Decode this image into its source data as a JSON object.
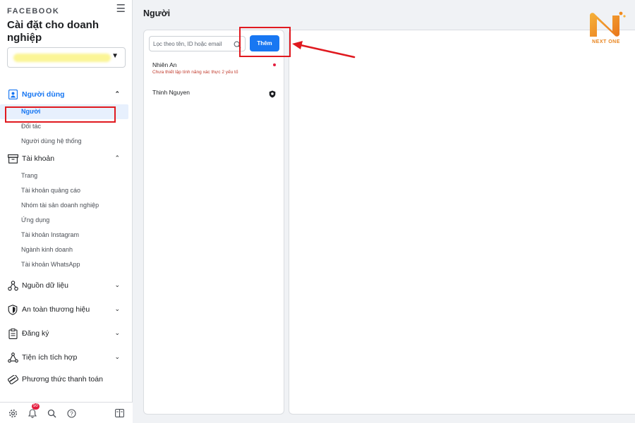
{
  "sidebar": {
    "brand": "FACEBOOK",
    "business_title": "Cài đặt cho doanh nghiệp",
    "sections": [
      {
        "label": "Người dùng",
        "expanded": true,
        "subitems": [
          "Người",
          "Đối tác",
          "Người dùng hệ thống"
        ]
      },
      {
        "label": "Tài khoản",
        "expanded": true,
        "subitems": [
          "Trang",
          "Tài khoản quảng cáo",
          "Nhóm tài sản doanh nghiệp",
          "Ứng dụng",
          "Tài khoản Instagram",
          "Ngành kinh doanh",
          "Tài khoản WhatsApp"
        ]
      },
      {
        "label": "Nguồn dữ liệu"
      },
      {
        "label": "An toàn thương hiệu"
      },
      {
        "label": "Đăng ký"
      },
      {
        "label": "Tiện ích tích hợp"
      },
      {
        "label": "Phương thức thanh toán"
      }
    ],
    "notification_count": "50"
  },
  "main": {
    "title": "Người",
    "search_placeholder": "Lọc theo tên, ID hoặc email",
    "add_label": "Thêm",
    "people": [
      {
        "name": "Nhiên An",
        "warning": "Chưa thiết lập tính năng xác thực 2 yếu tố"
      },
      {
        "name": "Thinh Nguyen"
      }
    ]
  },
  "logo": {
    "text": "NEXT ONE"
  },
  "colors": {
    "accent": "#1877f2",
    "highlight": "#e0191f",
    "logo": "#e9841d"
  }
}
